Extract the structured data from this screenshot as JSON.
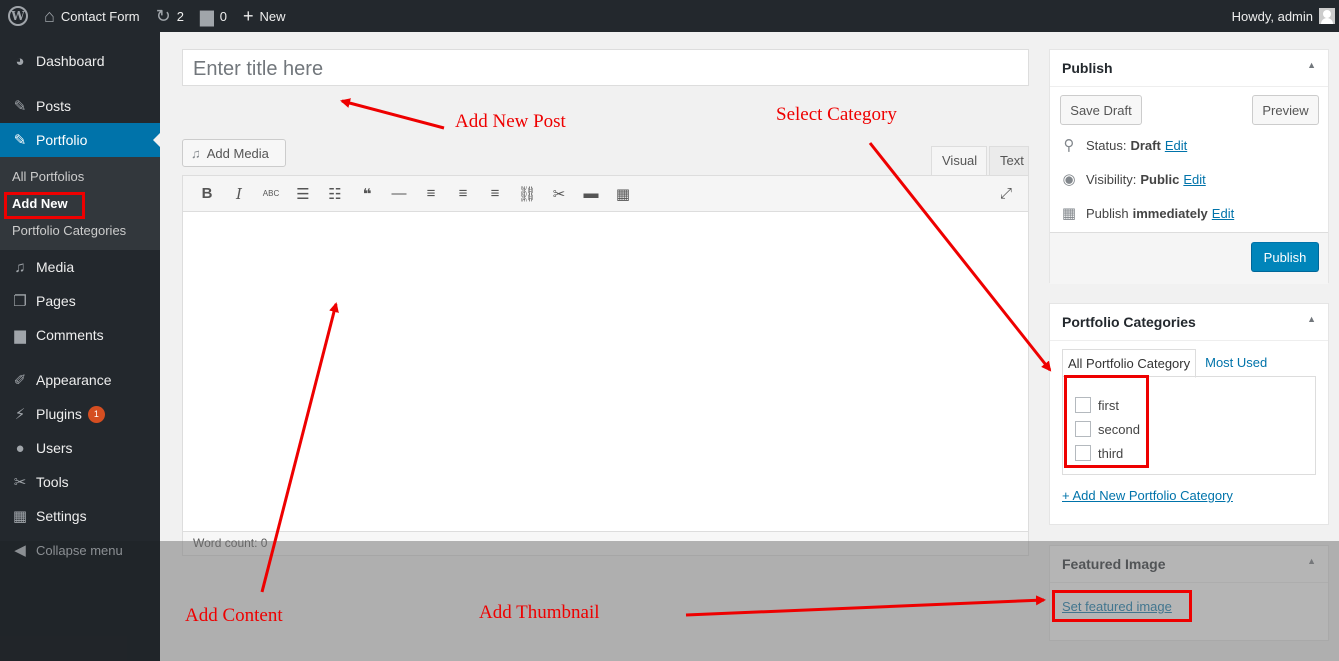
{
  "adminbar": {
    "site_name": "Contact Form",
    "updates_count": "2",
    "comments_count": "0",
    "new_label": "New",
    "howdy": "Howdy, admin"
  },
  "sidebar": {
    "items": [
      {
        "label": "Dashboard",
        "icon": "dashboard-icon"
      },
      {
        "label": "Posts",
        "icon": "pin-icon"
      },
      {
        "label": "Portfolio",
        "icon": "pin-icon"
      },
      {
        "label": "Media",
        "icon": "media-icon"
      },
      {
        "label": "Pages",
        "icon": "pages-icon"
      },
      {
        "label": "Comments",
        "icon": "comment-icon"
      },
      {
        "label": "Appearance",
        "icon": "brush-icon"
      },
      {
        "label": "Plugins",
        "icon": "plug-icon",
        "badge": "1"
      },
      {
        "label": "Users",
        "icon": "user-icon"
      },
      {
        "label": "Tools",
        "icon": "wrench-icon"
      },
      {
        "label": "Settings",
        "icon": "settings-icon"
      }
    ],
    "submenu": [
      "All Portfolios",
      "Add New",
      "Portfolio Categories"
    ],
    "collapse": "Collapse menu"
  },
  "editor": {
    "title_placeholder": "Enter title here",
    "add_media": "Add Media",
    "tab_visual": "Visual",
    "tab_text": "Text",
    "word_count": "Word count: 0"
  },
  "publish": {
    "title": "Publish",
    "save_draft": "Save Draft",
    "preview": "Preview",
    "status_label": "Status:",
    "status_value": "Draft",
    "visibility_label": "Visibility:",
    "visibility_value": "Public",
    "publish_label": "Publish",
    "publish_value": "immediately",
    "edit": "Edit",
    "publish_button": "Publish"
  },
  "categories": {
    "title": "Portfolio Categories",
    "tab_all": "All Portfolio Category",
    "tab_most_used": "Most Used",
    "items": [
      "first",
      "second",
      "third"
    ],
    "add_new": "+ Add New Portfolio Category"
  },
  "featured": {
    "title": "Featured Image",
    "set_link": "Set featured image"
  },
  "annotations": {
    "add_new_post": "Add New Post",
    "select_category": "Select Category",
    "add_content": "Add Content",
    "add_thumbnail": "Add Thumbnail"
  },
  "colors": {
    "admin_dark": "#23282d",
    "accent_blue": "#0073aa",
    "annotation_red": "#e00000"
  }
}
